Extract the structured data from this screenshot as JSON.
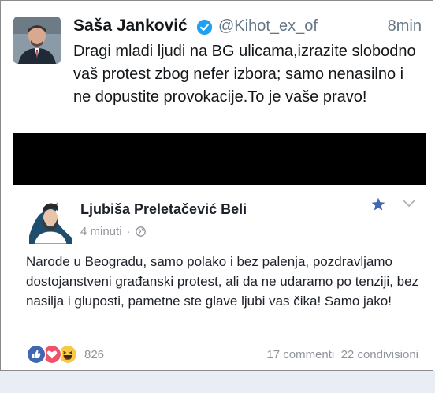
{
  "tweet": {
    "name": "Saša Janković",
    "handle": "@Kihot_ex_of",
    "time": "8min",
    "text": "Dragi mladi ljudi na BG ulicama,izrazite slobodno vaš protest zbog nefer izbora; samo nenasilno i ne dopustite provokacije.To je vaše pravo!"
  },
  "post": {
    "name": "Ljubiša Preletačević Beli",
    "time": "4 minuti",
    "separator": "·",
    "text": "Narode u Beogradu, samo polako i bez palenja, pozdravljamo dostojanstveni građanski protest, ali da ne udaramo po tenziji, bez nasilja i gluposti, pametne ste glave ljubi vas čika! Samo jako!",
    "reactions_count": "826",
    "comments": "17 commenti",
    "shares": "22 condivisioni",
    "icons": [
      "like-icon",
      "love-icon",
      "haha-icon",
      "star-icon",
      "chevron-down-icon",
      "globe-icon"
    ]
  },
  "colors": {
    "twitter_blue": "#1da1f2",
    "fb_blue": "#4267b2",
    "love_red": "#f25268",
    "haha_yellow": "#f7c945",
    "meta_gray": "#90949c"
  }
}
